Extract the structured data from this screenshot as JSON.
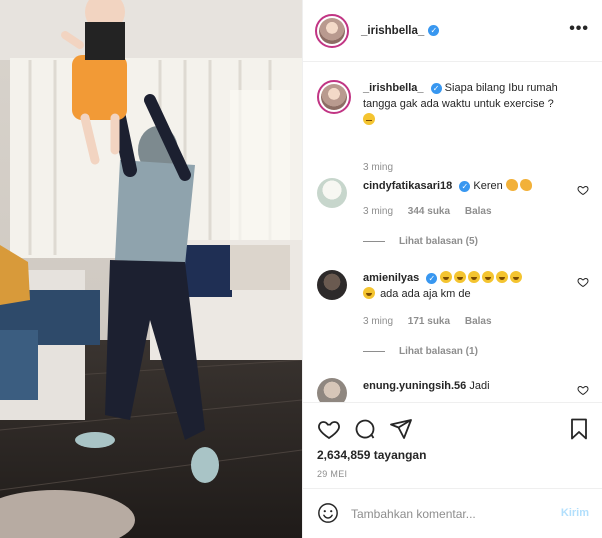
{
  "post": {
    "username": "_irishbella_",
    "more_icon": "more-horizontal-icon",
    "caption": {
      "username": "_irishbella_",
      "text": "Siapa bilang Ibu rumah tangga gak ada waktu untuk exercise ?",
      "time": "3 ming"
    }
  },
  "comments": [
    {
      "username": "cindyfatikasari18",
      "text": "Keren",
      "time": "3 ming",
      "likes": "344 suka",
      "reply_label": "Balas",
      "view_replies": "Lihat balasan (5)"
    },
    {
      "username": "amienilyas",
      "text": "ada ada aja km de",
      "time": "3 ming",
      "likes": "171 suka",
      "reply_label": "Balas",
      "view_replies": "Lihat balasan (1)"
    },
    {
      "username": "enung.yuningsih.56",
      "text": "Jadi"
    }
  ],
  "stats": {
    "views": "2,634,859 tayangan",
    "date": "29 MEI"
  },
  "add_comment": {
    "placeholder": "Tambahkan komentar...",
    "post_label": "Kirim"
  },
  "colors": {
    "verified": "#3897f0",
    "post_button_disabled": "#b2dffc",
    "muted_text": "#8e8e8e",
    "story_ring": "#c13584"
  }
}
